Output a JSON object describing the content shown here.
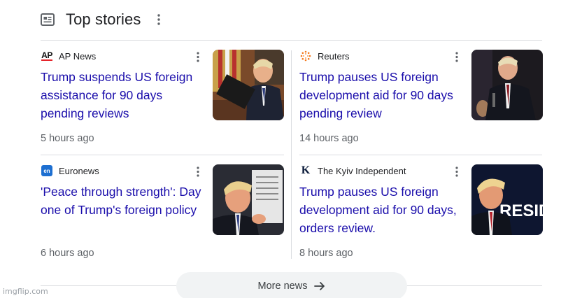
{
  "header": {
    "title": "Top stories",
    "icon": "newspaper-icon"
  },
  "stories": [
    {
      "source": "AP News",
      "source_logo_text": "AP",
      "headline": "Trump suspends US foreign assistance for 90 days pending reviews",
      "time": "5 hours ago"
    },
    {
      "source": "Reuters",
      "headline": "Trump pauses US foreign development aid for 90 days pending review",
      "time": "14 hours ago"
    },
    {
      "source": "Euronews",
      "source_logo_text": "en",
      "headline": "'Peace through strength': Day one of Trump's foreign policy",
      "time": "6 hours ago"
    },
    {
      "source": "The Kyiv Independent",
      "source_logo_text": "K",
      "headline": "Trump pauses US foreign development aid for 90 days, orders review.",
      "time": "8 hours ago"
    }
  ],
  "thumb4_text": "RESIDE",
  "more_button": {
    "label": "More news"
  },
  "watermark": "imgflip.com",
  "colors": {
    "headline": "#1a0dab",
    "meta": "#5f6368",
    "ap_red": "#e5252b",
    "reuters_orange": "#f47b20",
    "euronews_blue": "#1d6fd1"
  }
}
